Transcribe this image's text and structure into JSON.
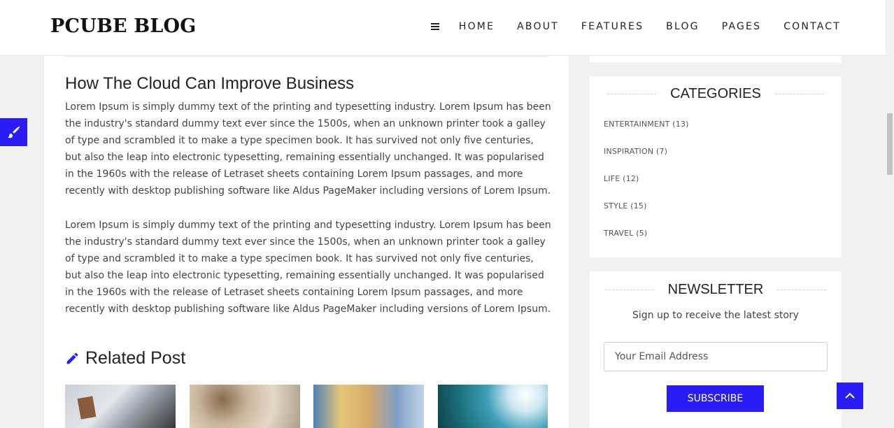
{
  "header": {
    "logo": "PCUBE BLOG",
    "nav": [
      "HOME",
      "ABOUT",
      "FEATURES",
      "BLOG",
      "PAGES",
      "CONTACT"
    ]
  },
  "article": {
    "title": "How The Cloud Can Improve Business",
    "paragraphs": [
      "Lorem Ipsum is simply dummy text of the printing and typesetting industry. Lorem Ipsum has been the industry's standard dummy text ever since the 1500s, when an unknown printer took a galley of type and scrambled it to make a type specimen book. It has survived not only five centuries, but also the leap into electronic typesetting, remaining essentially unchanged. It was popularised in the 1960s with the release of Letraset sheets containing Lorem Ipsum passages, and more recently with desktop publishing software like Aldus PageMaker including versions of Lorem Ipsum.",
      "Lorem Ipsum is simply dummy text of the printing and typesetting industry. Lorem Ipsum has been the industry's standard dummy text ever since the 1500s, when an unknown printer took a galley of type and scrambled it to make a type specimen book. It has survived not only five centuries, but also the leap into electronic typesetting, remaining essentially unchanged. It was popularised in the 1960s with the release of Letraset sheets containing Lorem Ipsum passages, and more recently with desktop publishing software like Aldus PageMaker including versions of Lorem Ipsum."
    ],
    "related_heading": "Related Post",
    "related_icon": "pencil-icon"
  },
  "categories": {
    "heading": "CATEGORIES",
    "items": [
      "ENTERTAINMENT (13)",
      "INSPIRATION (7)",
      "LIFE (12)",
      "STYLE (15)",
      "TRAVEL (5)"
    ]
  },
  "newsletter": {
    "heading": "NEWSLETTER",
    "subtitle": "Sign up to receive the latest story",
    "email_placeholder": "Your Email Address",
    "button": "SUBSCRIBE"
  },
  "colors": {
    "accent": "#2a1cf5"
  },
  "icons": {
    "menu": "hamburger-menu-icon",
    "style_switcher": "paint-brush-icon",
    "back_to_top": "chevron-up-icon"
  }
}
